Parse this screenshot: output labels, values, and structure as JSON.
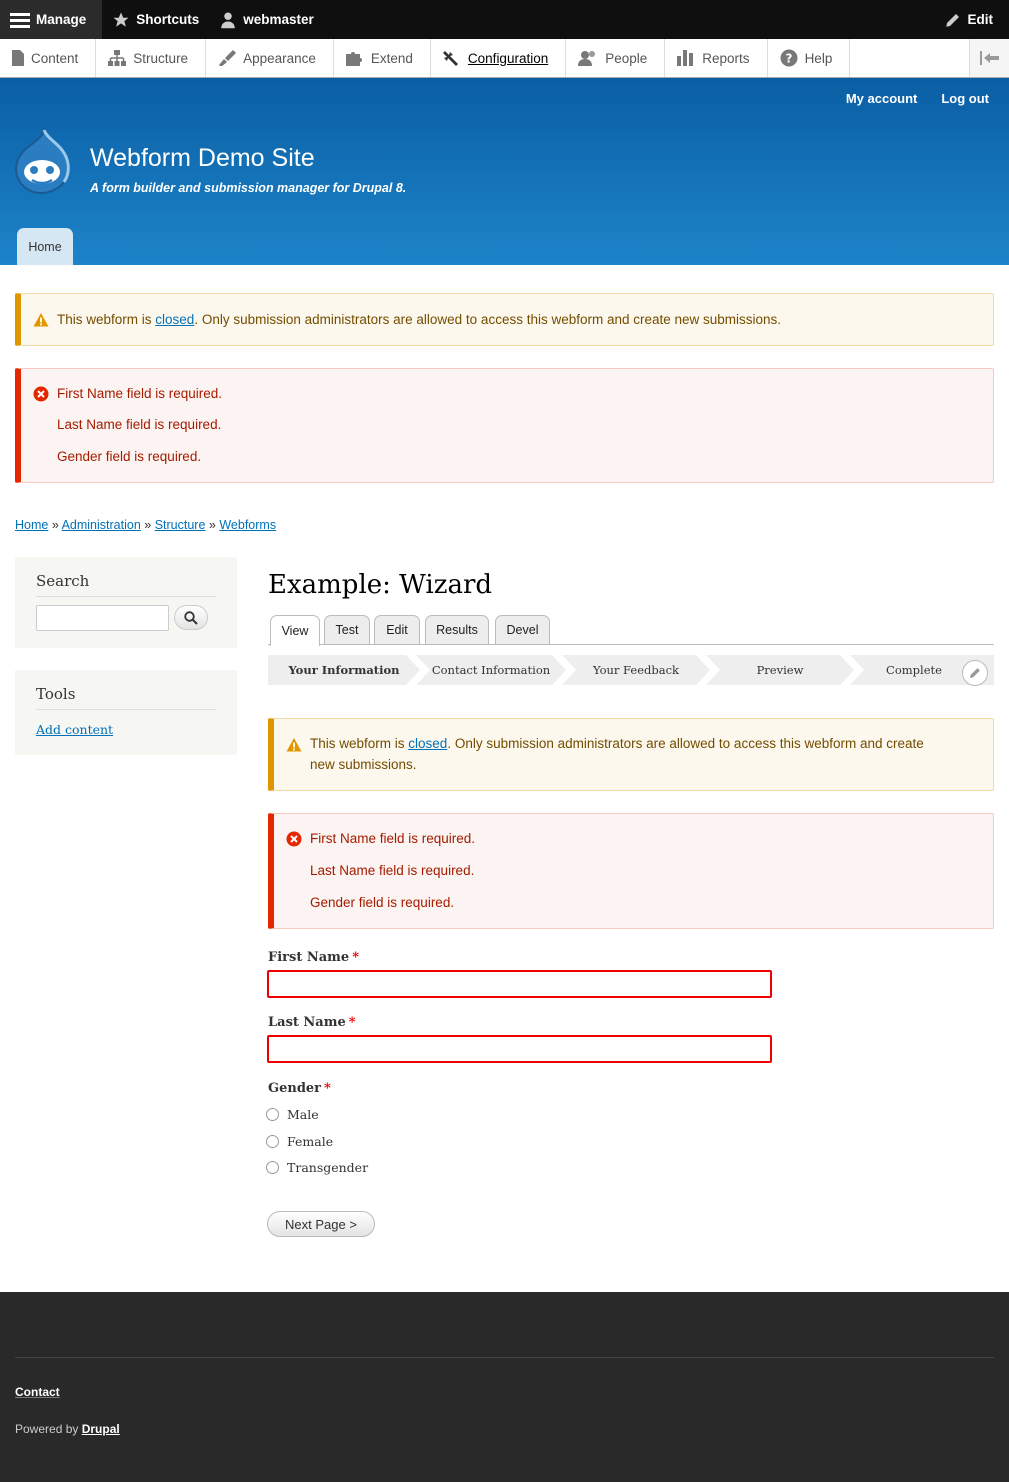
{
  "toolbar": {
    "manage": "Manage",
    "shortcuts": "Shortcuts",
    "user": "webmaster",
    "edit": "Edit"
  },
  "tray": {
    "items": [
      {
        "label": "Content",
        "icon": "file-icon"
      },
      {
        "label": "Structure",
        "icon": "sitemap-icon"
      },
      {
        "label": "Appearance",
        "icon": "paintbrush-icon"
      },
      {
        "label": "Extend",
        "icon": "puzzle-icon"
      },
      {
        "label": "Configuration",
        "icon": "wrench-icon"
      },
      {
        "label": "People",
        "icon": "people-icon"
      },
      {
        "label": "Reports",
        "icon": "bar-chart-icon"
      },
      {
        "label": "Help",
        "icon": "help-icon"
      }
    ]
  },
  "header": {
    "my_account": "My account",
    "log_out": "Log out",
    "site_name": "Webform Demo Site",
    "slogan": "A form builder and submission manager for Drupal 8.",
    "home_tab": "Home"
  },
  "messages": {
    "warning_pre": "This webform is ",
    "warning_link": "closed",
    "warning_post": ". Only submission administrators are allowed to access this webform and create new submissions.",
    "warning_post_main_1": ". Only submission administrators are allowed to access this webform and create",
    "warning_post_main_2": "new submissions.",
    "errors": [
      "First Name field is required.",
      "Last Name field is required.",
      "Gender field is required."
    ]
  },
  "breadcrumb": {
    "items": [
      "Home",
      "Administration",
      "Structure",
      "Webforms"
    ],
    "separator": "»"
  },
  "sidebar": {
    "search_title": "Search",
    "tools_title": "Tools",
    "add_content": "Add content"
  },
  "main": {
    "title": "Example: Wizard",
    "tabs": [
      "View",
      "Test",
      "Edit",
      "Results",
      "Devel"
    ],
    "steps": [
      "Your Information",
      "Contact Information",
      "Your Feedback",
      "Preview",
      "Complete"
    ],
    "form": {
      "first_name_label": "First Name",
      "last_name_label": "Last Name",
      "gender_label": "Gender",
      "required_mark": "*",
      "gender_options": [
        "Male",
        "Female",
        "Transgender"
      ],
      "next_button": "Next Page >"
    }
  },
  "footer": {
    "contact": "Contact",
    "powered_by": "Powered by ",
    "drupal": "Drupal"
  },
  "colors": {
    "header_blue": "#0a5ea4",
    "link": "#0071b8",
    "warning_border": "#e09600",
    "error_border": "#e62600",
    "footer_bg": "#292929"
  }
}
